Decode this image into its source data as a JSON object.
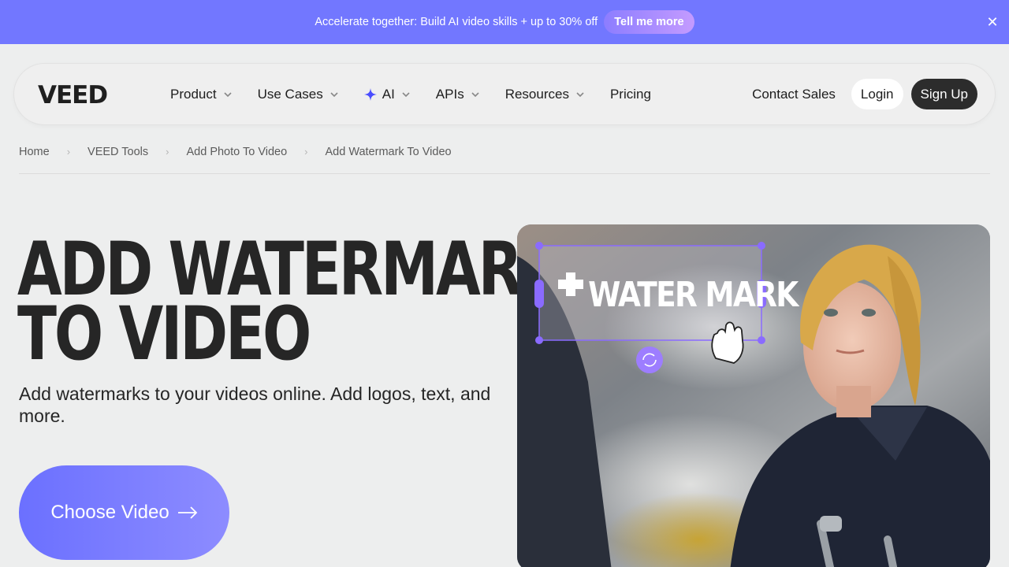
{
  "promo": {
    "message": "Accelerate together: Build AI video skills + up to 30% off",
    "cta_label": "Tell me more"
  },
  "nav": {
    "brand": "VEED",
    "items": [
      {
        "label": "Product",
        "has_dropdown": true
      },
      {
        "label": "Use Cases",
        "has_dropdown": true
      },
      {
        "label": "AI",
        "has_dropdown": true,
        "icon": "sparkle-icon"
      },
      {
        "label": "APIs",
        "has_dropdown": true
      },
      {
        "label": "Resources",
        "has_dropdown": true
      },
      {
        "label": "Pricing",
        "has_dropdown": false
      }
    ],
    "contact_label": "Contact Sales",
    "login_label": "Login",
    "signup_label": "Sign Up"
  },
  "breadcrumbs": [
    "Home",
    "VEED Tools",
    "Add Photo To Video",
    "Add Watermark To Video"
  ],
  "hero": {
    "title_line1": "ADD WATERMARK",
    "title_line2": "TO VIDEO",
    "subtitle": "Add watermarks to your videos online. Add logos, text, and more.",
    "cta_label": "Choose Video"
  },
  "media": {
    "watermark_text": "WATER MARK"
  },
  "colors": {
    "promo_bg": "#7277ff",
    "accent": "#6b70ff",
    "selection": "#8a6bff",
    "dark_button": "#2c2c2c"
  }
}
